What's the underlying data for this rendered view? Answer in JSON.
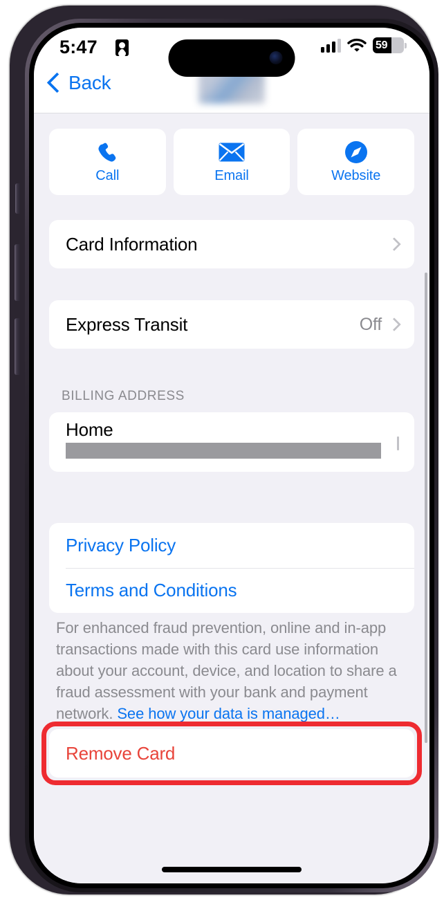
{
  "status_bar": {
    "time": "5:47",
    "recording_icon": "id-badge-icon",
    "cellular_icon": "cellular-signal-icon",
    "wifi_icon": "wifi-icon",
    "battery_percent": "59",
    "battery_level": 59
  },
  "nav": {
    "back_label": "Back",
    "back_icon": "chevron-left-icon",
    "card_thumbnail": "redacted-card-thumbnail"
  },
  "actions": [
    {
      "label": "Call",
      "icon": "phone-icon"
    },
    {
      "label": "Email",
      "icon": "envelope-icon"
    },
    {
      "label": "Website",
      "icon": "safari-compass-icon"
    }
  ],
  "rows": {
    "card_information": {
      "title": "Card Information",
      "chevron": "chevron-right-icon"
    },
    "express_transit": {
      "title": "Express Transit",
      "value": "Off",
      "chevron": "chevron-right-icon"
    }
  },
  "billing": {
    "section_header": "BILLING ADDRESS",
    "title": "Home",
    "address_redacted": "",
    "chevron": "chevron-right-icon"
  },
  "links": {
    "privacy_policy": "Privacy Policy",
    "terms_and_conditions": "Terms and Conditions"
  },
  "footer": {
    "text": "For enhanced fraud prevention, online and in-app transactions made with this card use information about your account, device, and location to share a fraud assessment with your bank and payment network. ",
    "link": "See how your data is managed…"
  },
  "remove": {
    "label": "Remove Card",
    "highlight_color": "#ee2b31",
    "text_color": "#e8443a"
  },
  "colors": {
    "accent_blue": "#0a74f0",
    "background": "#f1f0f6",
    "card": "#ffffff",
    "secondary_text": "#8a8a8f",
    "destructive": "#e8443a"
  }
}
